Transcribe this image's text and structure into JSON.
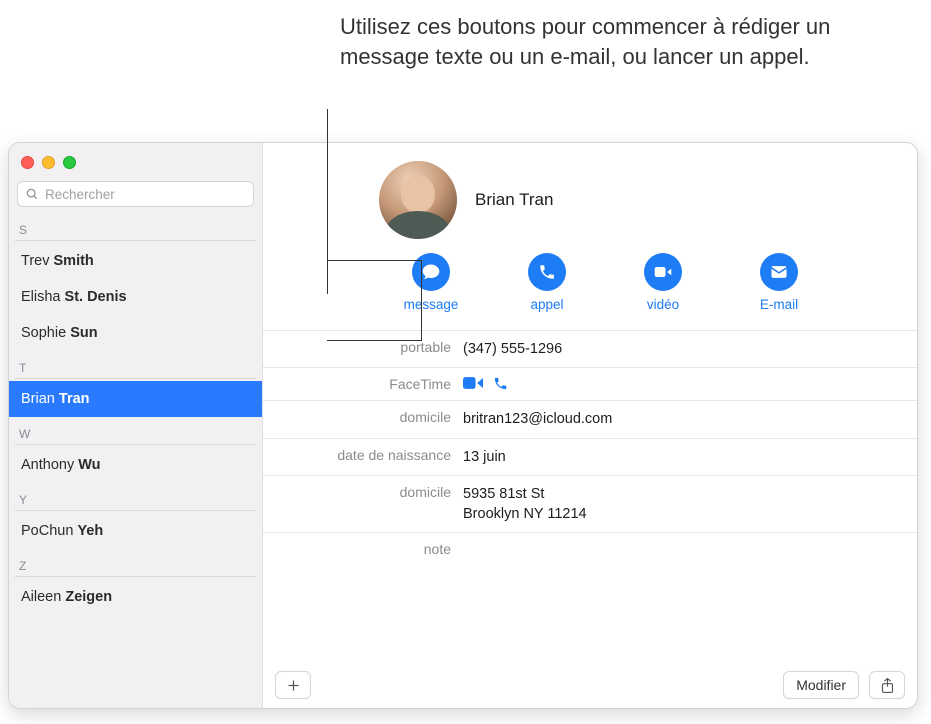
{
  "annotation": "Utilisez ces boutons pour commencer à rédiger un message texte ou un e-mail, ou lancer un appel.",
  "search": {
    "placeholder": "Rechercher"
  },
  "groups": [
    {
      "letter": "S",
      "items": [
        {
          "first": "Trev",
          "last": "Smith"
        },
        {
          "first": "Elisha",
          "last": "St. Denis"
        },
        {
          "first": "Sophie",
          "last": "Sun"
        }
      ]
    },
    {
      "letter": "T",
      "items": [
        {
          "first": "Brian",
          "last": "Tran",
          "selected": true
        }
      ]
    },
    {
      "letter": "W",
      "items": [
        {
          "first": "Anthony",
          "last": "Wu"
        }
      ]
    },
    {
      "letter": "Y",
      "items": [
        {
          "first": "PoChun",
          "last": "Yeh"
        }
      ]
    },
    {
      "letter": "Z",
      "items": [
        {
          "first": "Aileen",
          "last": "Zeigen"
        }
      ]
    }
  ],
  "contact": {
    "name": "Brian Tran",
    "actions": {
      "message": "message",
      "call": "appel",
      "video": "vidéo",
      "email": "E-mail"
    },
    "fields": {
      "phone_label": "portable",
      "phone_value": "(347) 555-1296",
      "facetime_label": "FaceTime",
      "email_label": "domicile",
      "email_value": "britran123@icloud.com",
      "birthday_label": "date de naissance",
      "birthday_value": "13 juin",
      "address_label": "domicile",
      "address_line1": "5935 81st St",
      "address_line2": "Brooklyn NY 11214",
      "note_label": "note"
    }
  },
  "buttons": {
    "edit": "Modifier"
  }
}
